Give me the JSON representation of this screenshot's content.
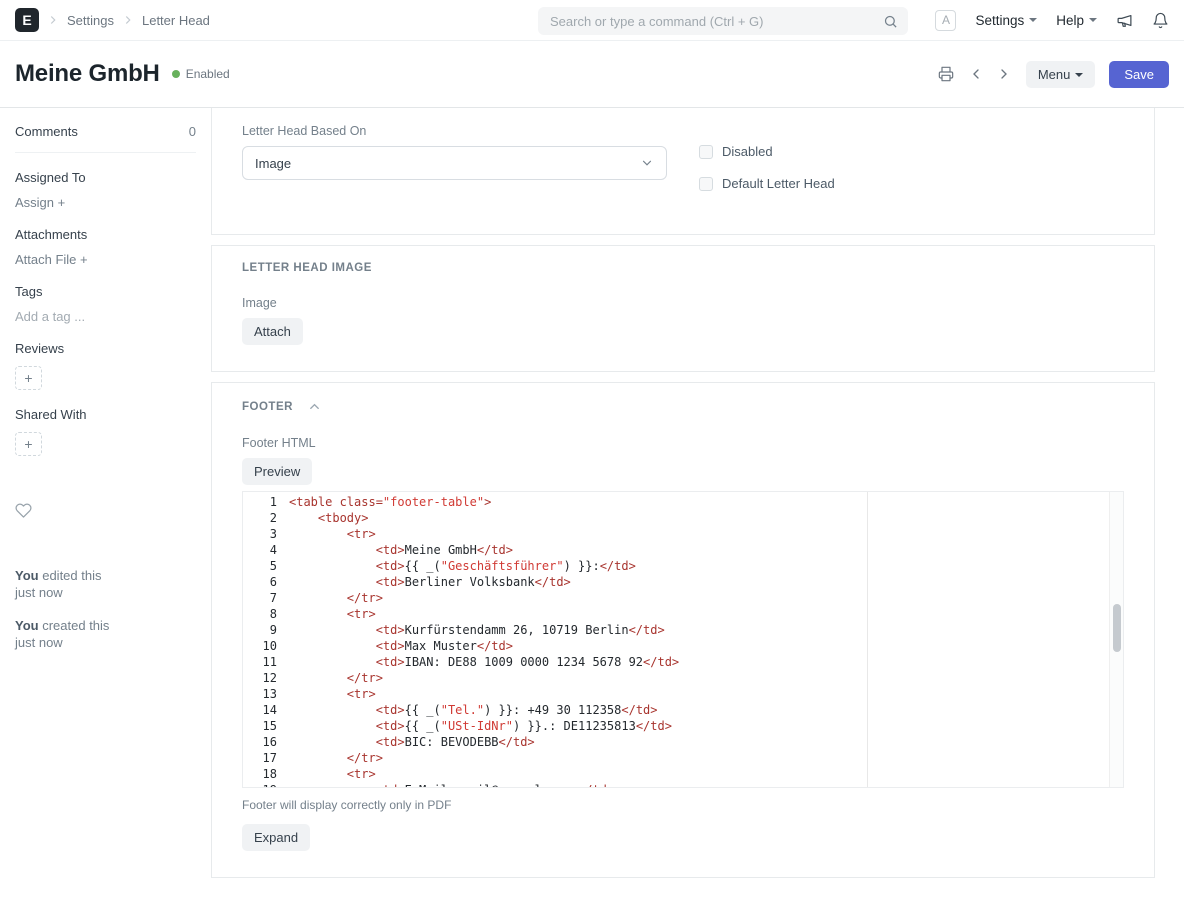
{
  "colors": {
    "accent": "#5664d2",
    "status_enabled": "#68b15c",
    "code_tag": "#a8342e",
    "code_string": "#d03a34"
  },
  "navbar": {
    "logo_letter": "E",
    "breadcrumbs": [
      "Settings",
      "Letter Head"
    ],
    "search_placeholder": "Search or type a command (Ctrl + G)",
    "user_initial": "A",
    "settings_menu": "Settings",
    "help_menu": "Help"
  },
  "header": {
    "title": "Meine GmbH",
    "status": "Enabled",
    "menu_button": "Menu",
    "save_button": "Save"
  },
  "sidebar": {
    "comments": {
      "label": "Comments",
      "count": "0"
    },
    "assigned_to": {
      "label": "Assigned To",
      "action": "Assign"
    },
    "attachments": {
      "label": "Attachments",
      "action": "Attach File"
    },
    "tags": {
      "label": "Tags",
      "placeholder": "Add a tag ..."
    },
    "reviews": {
      "label": "Reviews"
    },
    "shared_with": {
      "label": "Shared With"
    },
    "activity": [
      {
        "who": "You",
        "action": "edited this",
        "when": "just now"
      },
      {
        "who": "You",
        "action": "created this",
        "when": "just now"
      }
    ]
  },
  "form": {
    "based_on": {
      "label": "Letter Head Based On",
      "value": "Image"
    },
    "checkboxes": [
      {
        "label": "Disabled",
        "checked": false
      },
      {
        "label": "Default Letter Head",
        "checked": false
      }
    ],
    "image_section": {
      "title": "LETTER HEAD IMAGE",
      "field_label": "Image",
      "attach_button": "Attach"
    },
    "footer_section": {
      "title": "FOOTER",
      "field_label": "Footer HTML",
      "preview_button": "Preview",
      "note": "Footer will display correctly only in PDF",
      "expand_button": "Expand",
      "code_lines": [
        "<table class=\"footer-table\">",
        "    <tbody>",
        "        <tr>",
        "            <td>Meine GmbH</td>",
        "            <td>{{ _(\"Geschäftsführer\") }}:</td>",
        "            <td>Berliner Volksbank</td>",
        "        </tr>",
        "        <tr>",
        "            <td>Kurfürstendamm 26, 10719 Berlin</td>",
        "            <td>Max Muster</td>",
        "            <td>IBAN: DE88 1009 0000 1234 5678 92</td>",
        "        </tr>",
        "        <tr>",
        "            <td>{{ _(\"Tel.\") }}: +49 30 112358</td>",
        "            <td>{{ _(\"USt-IdNr\") }}.: DE11235813</td>",
        "            <td>BIC: BEVODEBB</td>",
        "        </tr>",
        "        <tr>",
        "            <td>E-Mail: mail@example.org</td>"
      ]
    }
  }
}
